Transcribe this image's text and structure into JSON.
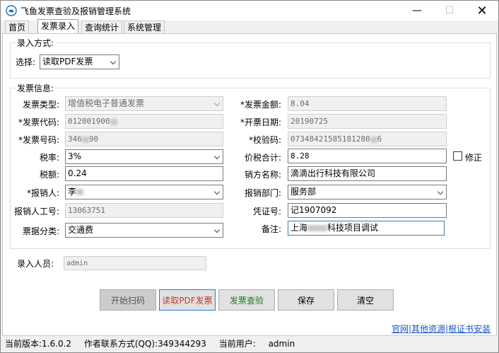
{
  "window": {
    "title": "飞鱼发票查验及报销管理系统"
  },
  "tabs": [
    "首页",
    "发票录入",
    "查询统计",
    "系统管理"
  ],
  "entry_mode": {
    "group_title": "录入方式:",
    "select_label": "选择:",
    "select_value": "读取PDF发票"
  },
  "invoice": {
    "group_title": "发票信息:",
    "type_label": "发票类型:",
    "type_value": "增值税电子普通发票",
    "code_label": "*发票代码:",
    "code_value": "012001900",
    "number_label": "*发票号码:",
    "number_value_a": "346",
    "number_value_b": "90",
    "tax_rate_label": "税率:",
    "tax_rate_value": "3%",
    "tax_amount_label": "税额:",
    "tax_amount_value": "0.24",
    "reimburser_label": "*报销人:",
    "reimburser_value": "李",
    "reimburser_id_label": "报销人工号:",
    "reimburser_id_value": "13063751",
    "category_label": "票据分类:",
    "category_value": "交通费",
    "amount_label": "*发票金额:",
    "amount_value": "8.04",
    "date_label": "*开票日期:",
    "date_value": "20190725",
    "check_label": "*校验码:",
    "check_value": "07348421585181280",
    "check_value_tail": "6",
    "total_label": "价税合计:",
    "total_value": "8.28",
    "correct_label": "修正",
    "seller_label": "销方名称:",
    "seller_value": "滴滴出行科技有限公司",
    "dept_label": "报销部门:",
    "dept_value": "服务部",
    "voucher_label": "凭证号:",
    "voucher_value": "记1907092",
    "remark_label": "备注:",
    "remark_value_a": "上海",
    "remark_value_b": "科技项目调试"
  },
  "operator": {
    "label": "录入人员:",
    "value": "admin"
  },
  "buttons": {
    "scan": "开始扫码",
    "read_pdf": "读取PDF发票",
    "verify": "发票查验",
    "save": "保存",
    "clear": "清空"
  },
  "links": {
    "website": "官网",
    "resources": "其他资源",
    "cert": "根证书安装",
    "sep": "|"
  },
  "status": {
    "version": "当前版本:1.6.0.2",
    "contact": "作者联系方式(QQ):349344293",
    "user_label": "当前用户:",
    "user_value": "admin"
  },
  "colors": {
    "link": "#1a56c6",
    "read_pdf_text": "#c0392b",
    "verify_text": "#1e7b1e"
  }
}
